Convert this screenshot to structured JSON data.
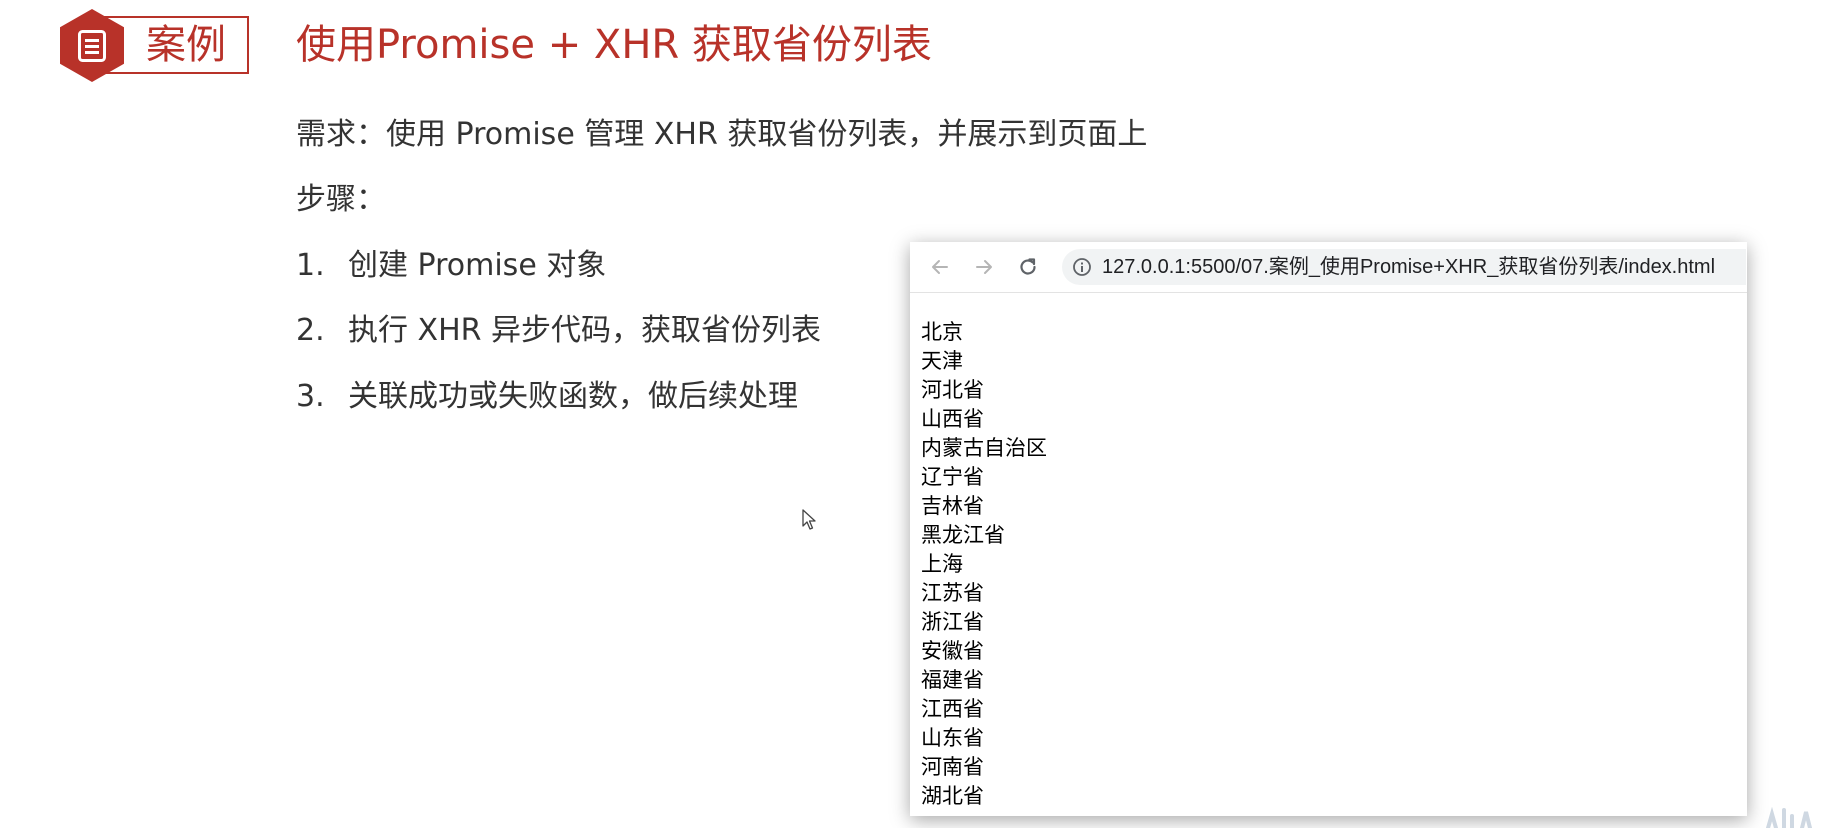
{
  "slide": {
    "badge": {
      "label": "案例",
      "icon": "document-list-icon",
      "color": "#b83229"
    },
    "title": "使用Promise + XHR 获取省份列表",
    "requirement": "需求：使用 Promise 管理 XHR 获取省份列表，并展示到页面上",
    "steps_label": "步骤：",
    "steps": [
      {
        "num": "1.",
        "text": "创建 Promise 对象"
      },
      {
        "num": "2.",
        "text": "执行 XHR 异步代码，获取省份列表"
      },
      {
        "num": "3.",
        "text": "关联成功或失败函数，做后续处理"
      }
    ]
  },
  "browser": {
    "nav_icons": [
      "back-arrow-icon",
      "forward-arrow-icon",
      "reload-icon"
    ],
    "url": "127.0.0.1:5500/07.案例_使用Promise+XHR_获取省份列表/index.html",
    "provinces": [
      "北京",
      "天津",
      "河北省",
      "山西省",
      "内蒙古自治区",
      "辽宁省",
      "吉林省",
      "黑龙江省",
      "上海",
      "江苏省",
      "浙江省",
      "安徽省",
      "福建省",
      "江西省",
      "山东省",
      "河南省",
      "湖北省"
    ]
  }
}
